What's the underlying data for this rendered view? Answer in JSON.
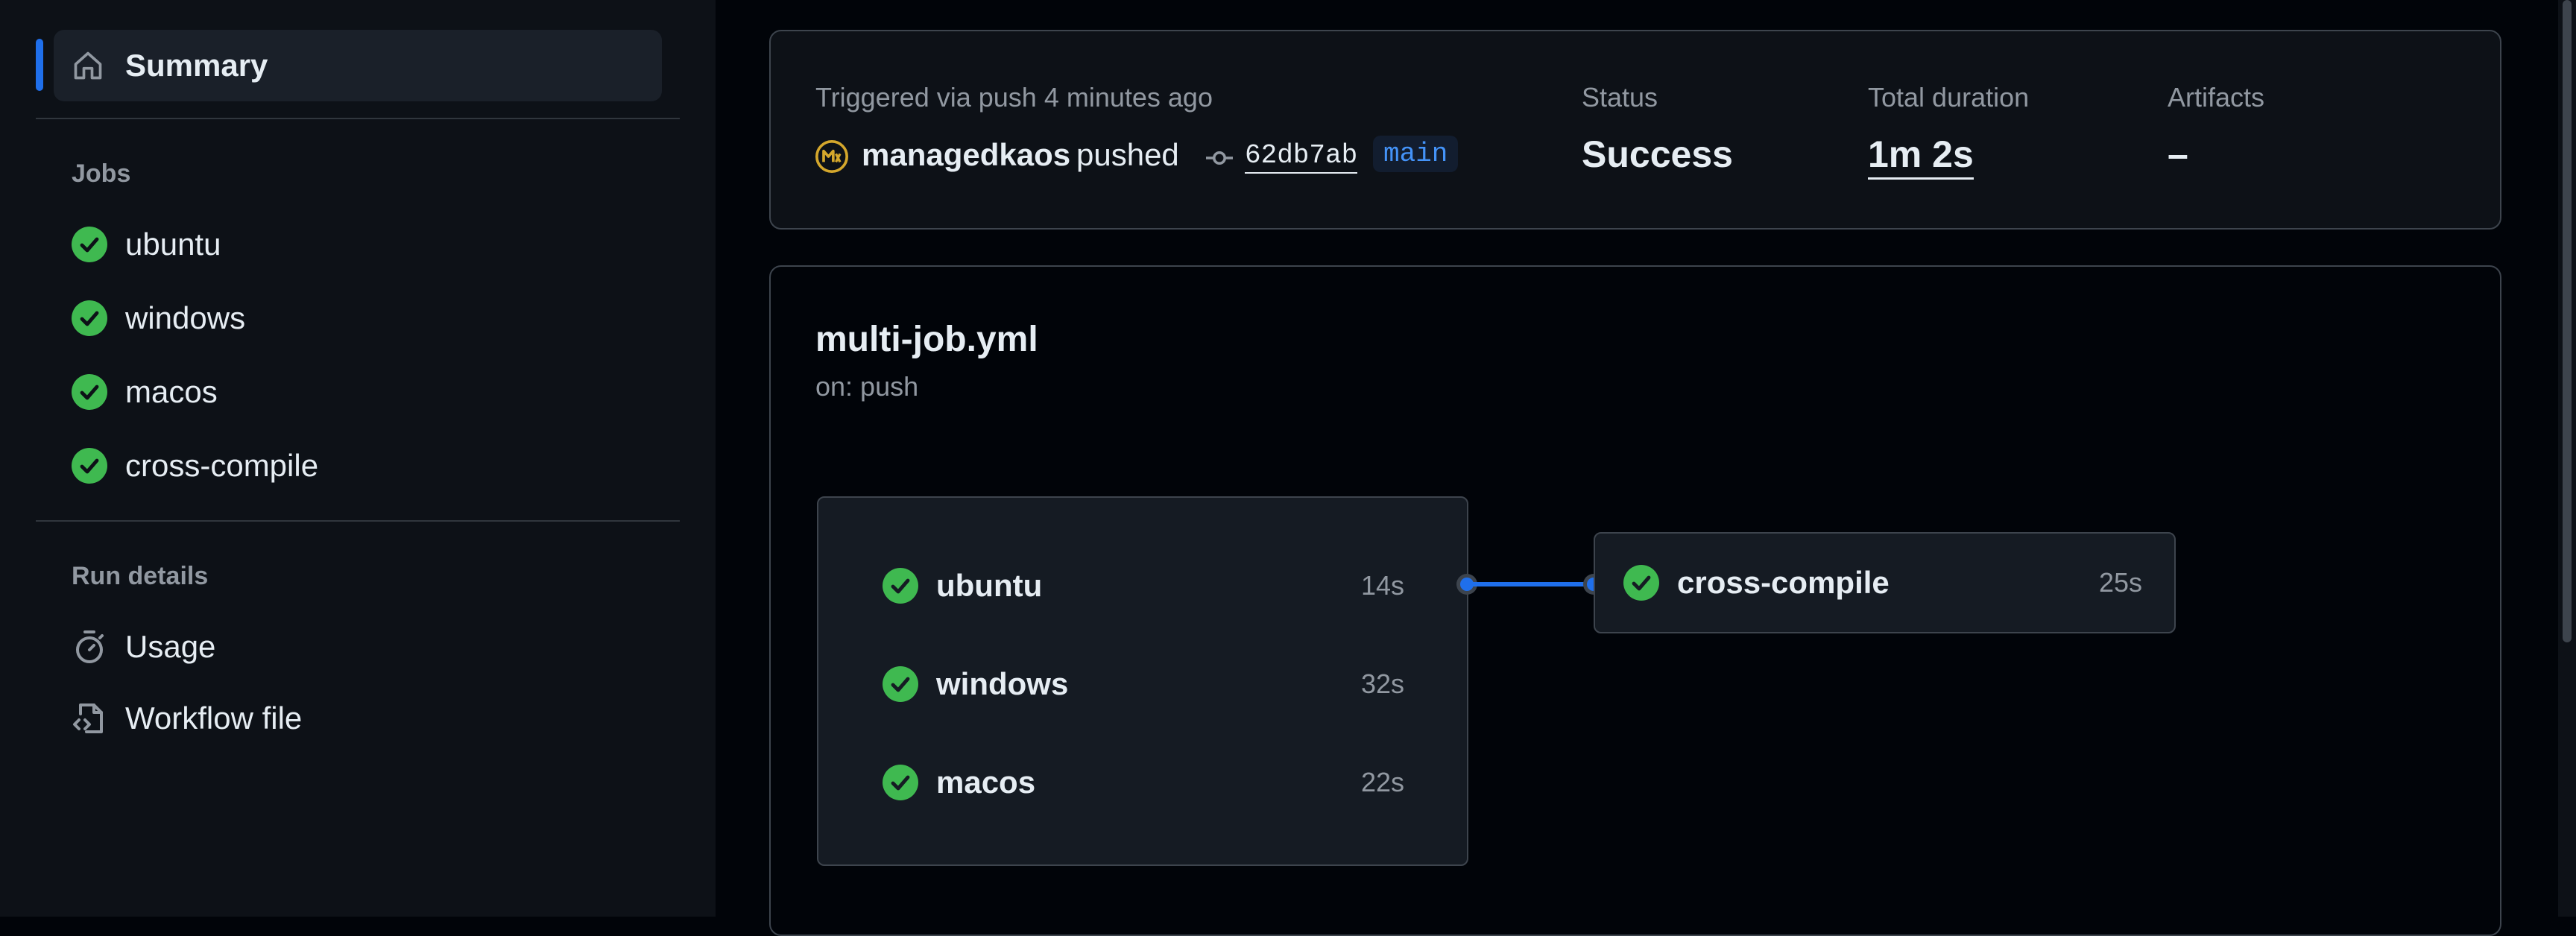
{
  "sidebar": {
    "summary_label": "Summary",
    "jobs_heading": "Jobs",
    "jobs": [
      {
        "label": "ubuntu"
      },
      {
        "label": "windows"
      },
      {
        "label": "macos"
      },
      {
        "label": "cross-compile"
      }
    ],
    "run_details_heading": "Run details",
    "details": [
      {
        "label": "Usage",
        "icon": "stopwatch-icon"
      },
      {
        "label": "Workflow file",
        "icon": "file-code-icon"
      }
    ]
  },
  "run": {
    "trigger_text": "Triggered via push 4 minutes ago",
    "actor": "managedkaos",
    "action": "pushed",
    "commit": "62db7ab",
    "branch": "main",
    "status_label": "Status",
    "status_value": "Success",
    "duration_label": "Total duration",
    "duration_value": "1m 2s",
    "artifacts_label": "Artifacts",
    "artifacts_value": "–"
  },
  "workflow": {
    "file": "multi-job.yml",
    "trigger": "on: push",
    "group_jobs": [
      {
        "name": "ubuntu",
        "duration": "14s"
      },
      {
        "name": "windows",
        "duration": "32s"
      },
      {
        "name": "macos",
        "duration": "22s"
      }
    ],
    "dependent_job": {
      "name": "cross-compile",
      "duration": "25s"
    }
  },
  "colors": {
    "success": "#3fb950",
    "accent": "#1f6feb",
    "link": "#4493f8",
    "avatar": "#d4a72c"
  }
}
